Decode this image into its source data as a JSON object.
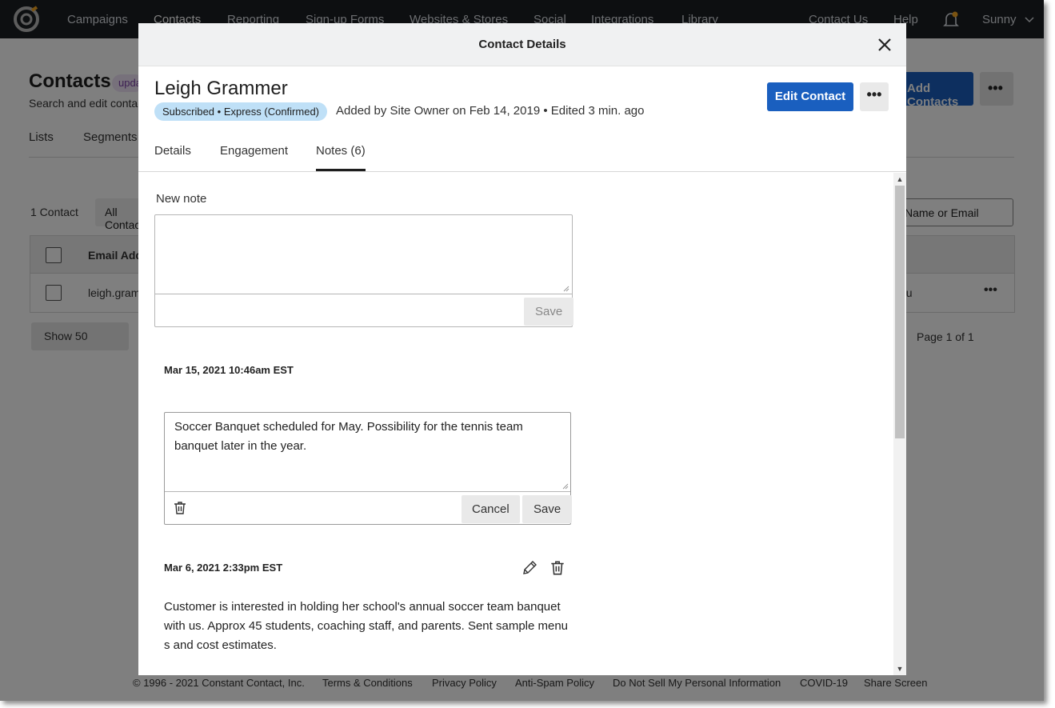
{
  "topnav": {
    "items": [
      "Campaigns",
      "Contacts",
      "Reporting",
      "Sign-up Forms",
      "Websites & Stores",
      "Social",
      "Integrations",
      "Library"
    ],
    "right": {
      "contact_us": "Contact Us",
      "help": "Help",
      "user": "Sunny"
    }
  },
  "page": {
    "title": "Contacts",
    "title_badge": "updated",
    "subtitle": "Search and edit contacts",
    "tabs": [
      "Lists",
      "Segments"
    ],
    "count": "1 Contact",
    "filter": "All Contacts",
    "search_placeholder": "Name or Email",
    "add_button": "Add Contacts",
    "table_header": "Email Address",
    "row_email": "leigh.grammer",
    "row_source": "you",
    "show": "Show 50",
    "pagination": "Page 1 of 1"
  },
  "footer": {
    "links": [
      "© 1996 - 2021 Constant Contact, Inc.",
      "Terms & Conditions",
      "Privacy Policy",
      "Anti-Spam Policy",
      "Do Not Sell My Personal Information",
      "COVID-19",
      "Share Screen"
    ]
  },
  "modal": {
    "title": "Contact Details",
    "contact_name": "Leigh Grammer",
    "status_badge": "Subscribed • Express (Confirmed)",
    "meta": "Added by Site Owner on Feb 14, 2019 • Edited 3 min. ago",
    "edit_button": "Edit Contact",
    "more_button": "•••",
    "tabs": [
      "Details",
      "Engagement",
      "Notes (6)"
    ],
    "active_tab": "Notes (6)",
    "new_note": {
      "label": "New note",
      "value": "",
      "save": "Save"
    },
    "notes": [
      {
        "date": "Mar 15, 2021 10:46am EST",
        "text": "Soccer Banquet scheduled for May. Possibility for the tennis team banquet later in the year.",
        "editing": true,
        "cancel": "Cancel",
        "save": "Save"
      },
      {
        "date": "Mar 6, 2021 2:33pm EST",
        "text": "Customer is interested in holding her school's annual soccer team banquet with us. Approx 45 students, coaching staff, and parents. Sent sample menu s and cost estimates.",
        "editing": false
      }
    ]
  },
  "colors": {
    "primary": "#1a5fbf",
    "nav_bg": "#1b1e22",
    "badge_bg": "#bfe0f7",
    "notification_dot": "#f5a623"
  }
}
